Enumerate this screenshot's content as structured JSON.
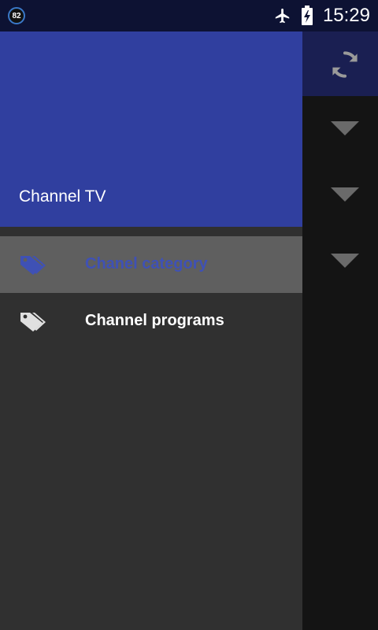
{
  "status_bar": {
    "notification_count": "82",
    "time": "15:29",
    "icons": [
      "airplane-mode-icon",
      "battery-charging-icon"
    ]
  },
  "drawer": {
    "header_title": "Channel TV",
    "items": [
      {
        "label": "Chanel category",
        "icon": "tags-icon",
        "active": true
      },
      {
        "label": "Channel programs",
        "icon": "tags-icon",
        "active": false
      }
    ]
  },
  "background_app": {
    "toolbar_action": "refresh-icon",
    "dropdown_count": 3
  },
  "colors": {
    "status_bar": "#0d1233",
    "drawer_header": "#303f9f",
    "drawer_body": "#303030",
    "active_item_bg": "#5f5f5f",
    "active_item_text": "#3f51b5",
    "app_toolbar": "#1a1f52",
    "app_background": "#141414"
  }
}
